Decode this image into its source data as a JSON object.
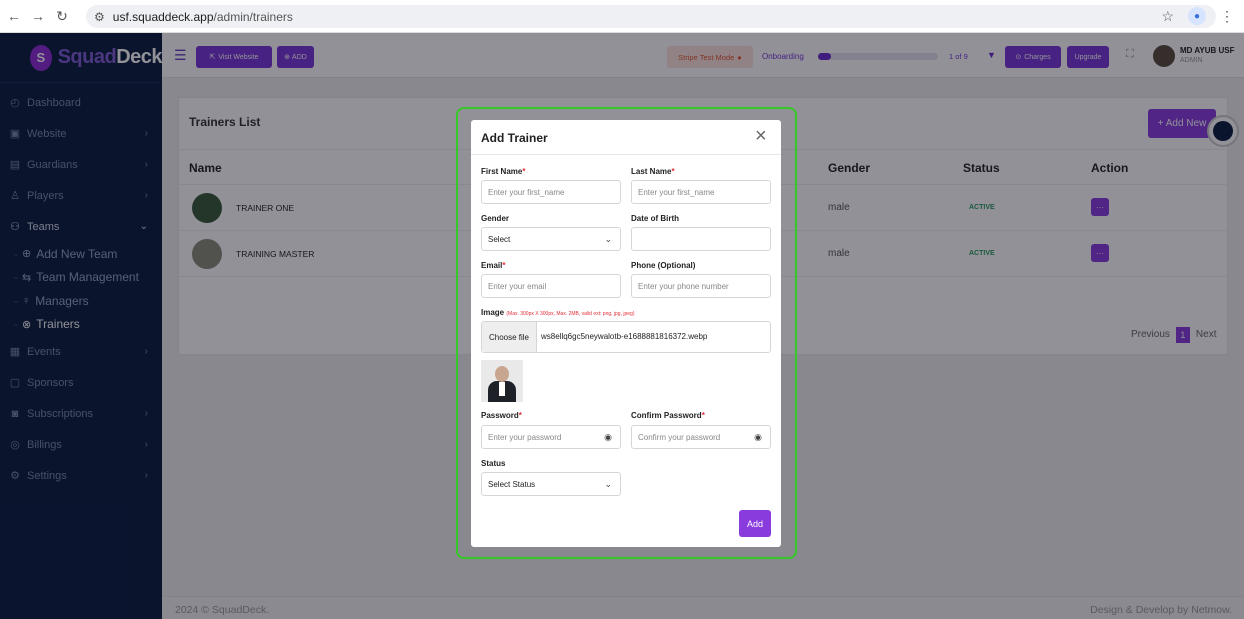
{
  "browser": {
    "url_host": "usf.squaddeck.app",
    "url_path": "/admin/trainers",
    "icons": [
      "back-arrow-icon",
      "forward-arrow-icon",
      "reload-icon",
      "site-settings-icon",
      "bookmark-star-icon",
      "profile-icon",
      "kebab-menu-icon"
    ]
  },
  "brand": {
    "name_part1": "Squad",
    "name_part2": "Deck",
    "accent": "#7b35d9"
  },
  "sidebar": {
    "items": [
      {
        "label": "Dashboard",
        "icon": "dashboard-icon"
      },
      {
        "label": "Website",
        "icon": "website-icon"
      },
      {
        "label": "Guardians",
        "icon": "guardians-icon"
      },
      {
        "label": "Players",
        "icon": "players-icon"
      },
      {
        "label": "Teams",
        "icon": "teams-icon"
      }
    ],
    "team_sub": [
      {
        "label": "Add New Team",
        "icon": "plus-circle-icon"
      },
      {
        "label": "Team Management",
        "icon": "sliders-icon"
      },
      {
        "label": "Managers",
        "icon": "user-icon"
      },
      {
        "label": "Trainers",
        "icon": "trainer-icon"
      }
    ],
    "items_after": [
      {
        "label": "Events",
        "icon": "calendar-icon"
      },
      {
        "label": "Sponsors",
        "icon": "sponsors-icon"
      },
      {
        "label": "Subscriptions",
        "icon": "subscriptions-icon"
      },
      {
        "label": "Billings",
        "icon": "billings-icon"
      },
      {
        "label": "Settings",
        "icon": "settings-icon"
      }
    ]
  },
  "topbar": {
    "visit_website": "Visit Website",
    "add": "ADD",
    "stripe_mode": "Stripe Test Mode",
    "onboarding_label": "Onboarding",
    "onboarding_count": "1 of 9",
    "onboarding_progress": 0.11,
    "charges": "Charges",
    "upgrade": "Upgrade",
    "user_name": "MD AYUB USF",
    "user_role": "ADMIN"
  },
  "trainers_list": {
    "title": "Trainers List",
    "add_new": "+ Add New",
    "columns": {
      "name": "Name",
      "gender": "Gender",
      "status": "Status",
      "action": "Action"
    },
    "rows": [
      {
        "name": "TRAINER ONE",
        "gender": "male",
        "status": "ACTIVE"
      },
      {
        "name": "TRAINING MASTER",
        "gender": "male",
        "status": "ACTIVE"
      }
    ],
    "action_label": "···",
    "pagination": {
      "previous": "Previous",
      "current": "1",
      "next": "Next"
    }
  },
  "modal": {
    "title": "Add Trainer",
    "close": "×",
    "first_name": {
      "label": "First Name",
      "placeholder": "Enter your first_name"
    },
    "last_name": {
      "label": "Last Name",
      "placeholder": "Enter your first_name"
    },
    "gender": {
      "label": "Gender",
      "value": "Select"
    },
    "dob": {
      "label": "Date of Birth",
      "value": ""
    },
    "email": {
      "label": "Email",
      "placeholder": "Enter your email"
    },
    "phone": {
      "label": "Phone (Optional)",
      "placeholder": "Enter your phone number"
    },
    "image": {
      "label": "Image",
      "hint": "(Max. 300px X 300px, Max. 2MB, valid ext: png, jpg, jpeg)",
      "choose_file": "Choose file",
      "file_name": "ws8ellq6gc5neywalotb-e1688881816372.webp"
    },
    "password": {
      "label": "Password",
      "placeholder": "Enter your password"
    },
    "confirm_password": {
      "label": "Confirm Password",
      "placeholder": "Confirm your password"
    },
    "status": {
      "label": "Status",
      "value": "Select Status"
    },
    "submit": "Add",
    "required_mark": "*"
  },
  "footer": {
    "left": "2024 © SquadDeck.",
    "right": "Design & Develop by Netmow."
  }
}
